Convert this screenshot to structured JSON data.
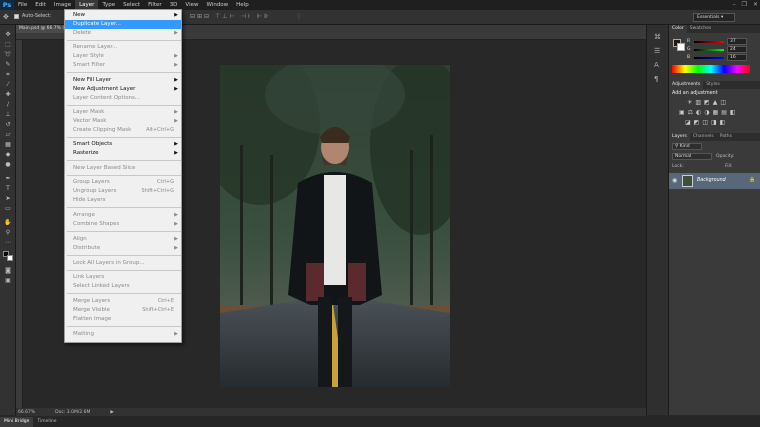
{
  "app": {
    "logo": "Ps",
    "workspace": "Essentials"
  },
  "menubar": [
    "File",
    "Edit",
    "Image",
    "Layer",
    "Type",
    "Select",
    "Filter",
    "3D",
    "View",
    "Window",
    "Help"
  ],
  "options_bar": {
    "auto_select": "Auto-Select:"
  },
  "document": {
    "tab_title": "Main.psd @ 66.7% (R..."
  },
  "layer_menu": {
    "new": "New",
    "duplicate_layer": "Duplicate Layer...",
    "delete": "Delete",
    "rename_layer": "Rename Layer...",
    "layer_style": "Layer Style",
    "smart_filter": "Smart Filter",
    "new_fill_layer": "New Fill Layer",
    "new_adjustment_layer": "New Adjustment Layer",
    "layer_content_options": "Layer Content Options...",
    "layer_mask": "Layer Mask",
    "vector_mask": "Vector Mask",
    "create_clipping_mask": "Create Clipping Mask",
    "create_clipping_mask_sc": "Alt+Ctrl+G",
    "smart_objects": "Smart Objects",
    "rasterize": "Rasterize",
    "new_layer_based_slice": "New Layer Based Slice",
    "group_layers": "Group Layers",
    "group_layers_sc": "Ctrl+G",
    "ungroup_layers": "Ungroup Layers",
    "ungroup_layers_sc": "Shift+Ctrl+G",
    "hide_layers": "Hide Layers",
    "arrange": "Arrange",
    "combine_shapes": "Combine Shapes",
    "align": "Align",
    "distribute": "Distribute",
    "lock_all_layers": "Lock All Layers in Group...",
    "link_layers": "Link Layers",
    "select_linked_layers": "Select Linked Layers",
    "merge_layers": "Merge Layers",
    "merge_layers_sc": "Ctrl+E",
    "merge_visible": "Merge Visible",
    "merge_visible_sc": "Shift+Ctrl+E",
    "flatten_image": "Flatten Image",
    "matting": "Matting"
  },
  "status": {
    "zoom": "66.67%",
    "doc": "Doc: 3.0M/2.6M"
  },
  "bottom_tabs": [
    "Mini Bridge",
    "Timeline"
  ],
  "color_panel": {
    "tabs": [
      "Color",
      "Swatches"
    ],
    "r_label": "R",
    "g_label": "G",
    "b_label": "B",
    "r": "37",
    "g": "24",
    "b": "16"
  },
  "adjustments_panel": {
    "tabs": [
      "Adjustments",
      "Styles"
    ],
    "heading": "Add an adjustment"
  },
  "layers_panel": {
    "tabs": [
      "Layers",
      "Channels",
      "Paths"
    ],
    "filter": "Kind",
    "blend_mode": "Normal",
    "opacity_label": "Opacity:",
    "lock_label": "Lock:",
    "fill_label": "Fill:",
    "layer_name": "Background"
  },
  "colors": {
    "highlight": "#3399ff",
    "menu_bg": "#f0f0f0",
    "ui_dark": "#323232"
  }
}
